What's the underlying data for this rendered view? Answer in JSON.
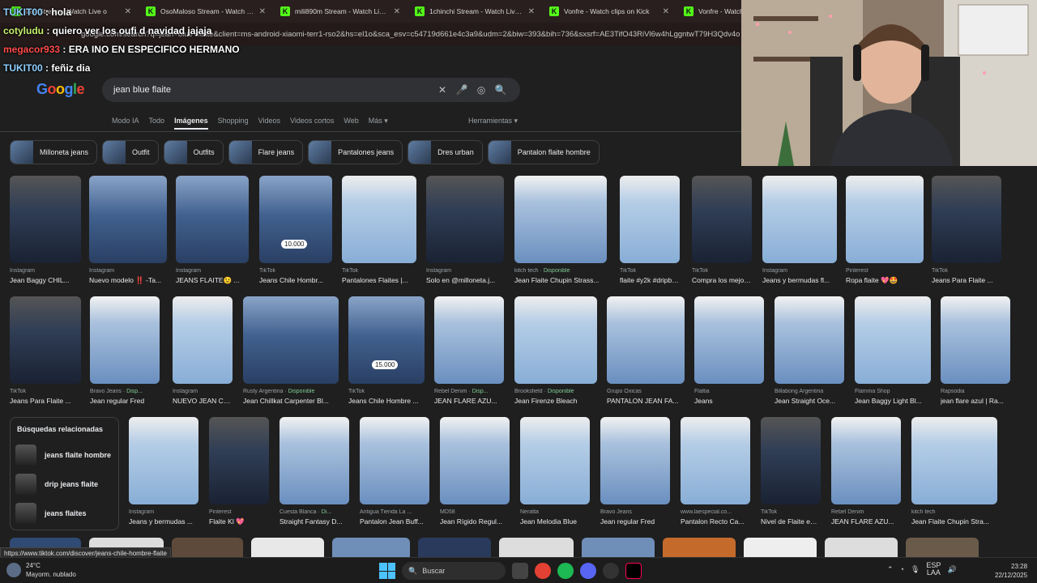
{
  "tabs": [
    {
      "label": "lam Stream - Watch Live o",
      "icon": "kick-icon"
    },
    {
      "label": "OsoMaloso Stream - Watch Liv",
      "icon": "kick-icon"
    },
    {
      "label": "mili890m Stream - Watch Live c",
      "icon": "kick-icon"
    },
    {
      "label": "1chinchi Stream - Watch Live o",
      "icon": "kick-icon"
    },
    {
      "label": "Vonfre - Watch clips on Kick",
      "icon": "kick-icon"
    },
    {
      "label": "Vonfre - Watch clips",
      "icon": "kick-icon"
    }
  ],
  "url": "google.com/search?q=jean+blue+flaite&client=ms-android-xiaomi-terr1-rso2&hs=el1o&sca_esv=c54719d661e4c3a9&udm=2&biw=393&bih=736&sxsrf=AE3TifO43RiVl6w4hLggntwT79H3Qdv4o",
  "chat": [
    {
      "user": "TUKIT00",
      "msg": "hola"
    },
    {
      "user": "cotyludu",
      "msg": "quiero ver los oufi d navidad jajaja"
    },
    {
      "user": "megacor933",
      "msg": "ERA INO EN ESPECIFICO HERMANO"
    },
    {
      "user": "TUKIT00",
      "msg": "feñiz dia"
    }
  ],
  "search": {
    "query": "jean blue flaite",
    "clear": "✕",
    "mic": "🎤",
    "lens": "◎",
    "go": "🔍"
  },
  "nav": {
    "items": [
      "Modo IA",
      "Todo",
      "Imágenes",
      "Shopping",
      "Videos",
      "Videos cortos",
      "Web",
      "Más ▾"
    ],
    "active": "Imágenes",
    "tools": "Herramientas ▾"
  },
  "chips": [
    "Milloneta jeans",
    "Outfit",
    "Outfits",
    "Flare jeans",
    "Pantalones jeans",
    "Dres urban",
    "Pantalon flaite hombre"
  ],
  "row1": [
    {
      "src": "Instagram",
      "title": "Jean Baggy CHIL...",
      "style": "dark"
    },
    {
      "src": "Instagram",
      "title": "Nuevo modelo ‼️ -Ta...",
      "style": ""
    },
    {
      "src": "Instagram",
      "title": "JEANS FLAITE😉 ...",
      "style": ""
    },
    {
      "src": "TikTok",
      "title": "Jeans Chile Hombr...",
      "style": "",
      "price": "10.000"
    },
    {
      "src": "TikTok",
      "title": "Pantalones Flaites |...",
      "style": "lb"
    },
    {
      "src": "Instagram",
      "title": "Solo en @milloneta.j...",
      "style": "dark"
    },
    {
      "src": "kitch tech",
      "avail": "Disponible",
      "title": "Jean Flaite Chupin Strass...",
      "style": "light"
    },
    {
      "src": "TikTok",
      "title": "flaite #y2k #dripbol...",
      "style": "lb"
    },
    {
      "src": "TikTok",
      "title": "Compra los mejore...",
      "style": "dark"
    },
    {
      "src": "Instagram",
      "title": "Jeans y bermudas fl...",
      "style": "lb"
    },
    {
      "src": "Pinterest",
      "title": "Ropa flaite 💖🤩",
      "style": "lb"
    },
    {
      "src": "TikTok",
      "title": "Jeans Para Flaite ...",
      "style": "dark"
    }
  ],
  "row2": [
    {
      "src": "TikTok",
      "title": "Jeans Para Flaite ...",
      "style": "dark"
    },
    {
      "src": "Bravo Jeans",
      "avail": "Disp...",
      "title": "Jean regular Fred",
      "style": "light"
    },
    {
      "src": "Instagram",
      "title": "NUEVO JEAN CA...",
      "style": "lb"
    },
    {
      "src": "Rusty Argentina",
      "avail": "Disponible",
      "title": "Jean Chillkat Carpenter Bl...",
      "style": ""
    },
    {
      "src": "TikTok",
      "title": "Jeans Chile Hombre ...",
      "style": "",
      "price": "15.000"
    },
    {
      "src": "Rebel Denim",
      "avail": "Disp...",
      "title": "JEAN FLARE AZU...",
      "style": "light"
    },
    {
      "src": "Brooksfield",
      "avail": "Disponible",
      "title": "Jean Firenze Bleach",
      "style": "lb"
    },
    {
      "src": "Grupo Oxicas",
      "title": "PANTALON JEAN FA...",
      "style": "light"
    },
    {
      "src": "Flaltia",
      "title": "Jeans",
      "style": "light"
    },
    {
      "src": "Billabong Argentina",
      "title": "Jean Straight Oce...",
      "style": "light"
    },
    {
      "src": "Flamma Shop",
      "title": "Jean Baggy Light Bl...",
      "style": "lb"
    },
    {
      "src": "Rapsodia",
      "title": "jean flare azul | Ra...",
      "style": "light"
    }
  ],
  "row3": [
    {
      "src": "Instagram",
      "title": "Jeans y bermudas ...",
      "style": "lb"
    },
    {
      "src": "Pinterest",
      "title": "Flaite Kl 💖",
      "style": "dark"
    },
    {
      "src": "Cuesta Blanca",
      "avail": "Di...",
      "title": "Straight Fantasy D...",
      "style": "light"
    },
    {
      "src": "Antigua Tienda La ...",
      "title": "Pantalon Jean Buff...",
      "style": "light"
    },
    {
      "src": "MD58",
      "title": "Jean Rígido Regul...",
      "style": "light"
    },
    {
      "src": "Neratta",
      "title": "Jean Melodia Blue",
      "style": "lb"
    },
    {
      "src": "Bravo Jeans",
      "title": "Jean regular Fred",
      "style": "light"
    },
    {
      "src": "www.laespecial.co...",
      "title": "Pantalon Recto Ca...",
      "style": "lb"
    },
    {
      "src": "TikTok",
      "title": "Nivel de Flaite en ...",
      "style": "dark"
    },
    {
      "src": "Rebel Denim",
      "title": "JEAN FLARE AZU...",
      "style": "light"
    },
    {
      "src": "kitch tech",
      "title": "Jean Flaite Chupin Stra...",
      "style": "lb"
    }
  ],
  "related": {
    "title": "Búsquedas relacionadas",
    "items": [
      "jeans flaite hombre",
      "drip jeans flaite",
      "jeans flaites"
    ]
  },
  "status_url": "https://www.tiktok.com/discover/jeans-chile-hombre-flaite",
  "taskbar": {
    "temp": "24°C",
    "weather": "Mayorm. nublado",
    "search": "Buscar",
    "lang1": "ESP",
    "lang2": "LAA",
    "time": "23:28",
    "date": "22/12/2025",
    "badge": "4"
  }
}
